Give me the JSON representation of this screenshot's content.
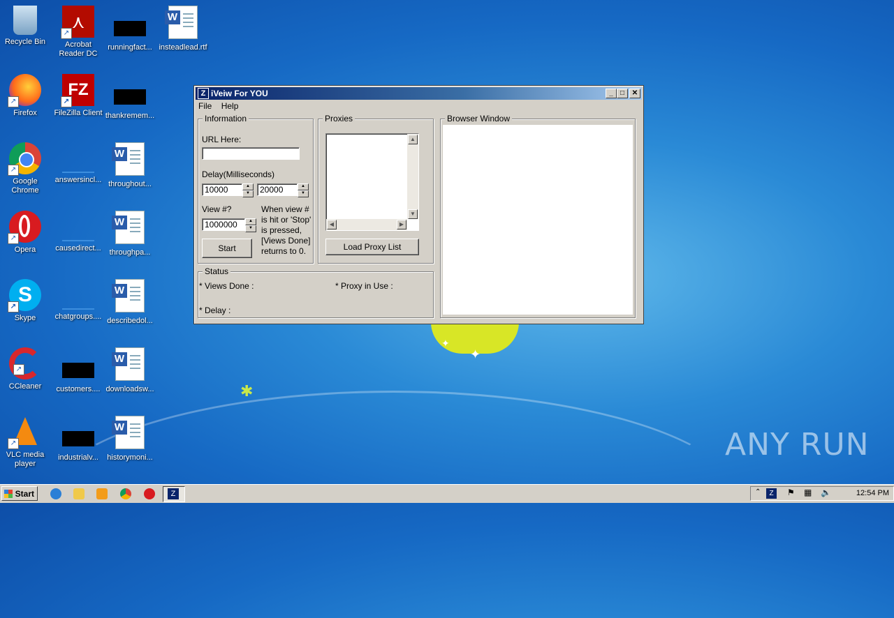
{
  "desktop": {
    "icons": [
      {
        "label": "Recycle Bin"
      },
      {
        "label": "Acrobat Reader DC"
      },
      {
        "label": "runningfact..."
      },
      {
        "label": "insteadlead.rtf"
      },
      {
        "label": "Firefox"
      },
      {
        "label": "FileZilla Client"
      },
      {
        "label": "thankremem..."
      },
      {
        "label": "Google Chrome"
      },
      {
        "label": "answersincl..."
      },
      {
        "label": "throughout..."
      },
      {
        "label": "Opera"
      },
      {
        "label": "causedirect..."
      },
      {
        "label": "throughpa..."
      },
      {
        "label": "Skype"
      },
      {
        "label": "chatgroups...."
      },
      {
        "label": "describedol..."
      },
      {
        "label": "CCleaner"
      },
      {
        "label": "customers...."
      },
      {
        "label": "downloadsw..."
      },
      {
        "label": "VLC media player"
      },
      {
        "label": "industrialv..."
      },
      {
        "label": "historymoni..."
      }
    ],
    "watermark": "ANY RUN"
  },
  "window": {
    "title": "iVeiw For YOU",
    "menu": [
      "File",
      "Help"
    ],
    "information": {
      "group_title": "Information",
      "url_label": "URL Here:",
      "url_value": "",
      "delay_label": "Delay(Milliseconds)",
      "delay_min": "10000",
      "delay_max": "20000",
      "view_label": "View #?",
      "view_value": "1000000",
      "note": "When view # is hit or 'Stop' is pressed, [Views Done] returns to 0.",
      "start_label": "Start"
    },
    "proxies": {
      "group_title": "Proxies",
      "load_label": "Load Proxy List"
    },
    "browser": {
      "group_title": "Browser Window"
    },
    "status": {
      "group_title": "Status",
      "views_done": "* Views Done :",
      "proxy_in_use": "* Proxy in Use :",
      "delay": "* Delay :"
    }
  },
  "taskbar": {
    "start_label": "Start",
    "clock": "12:54 PM"
  }
}
